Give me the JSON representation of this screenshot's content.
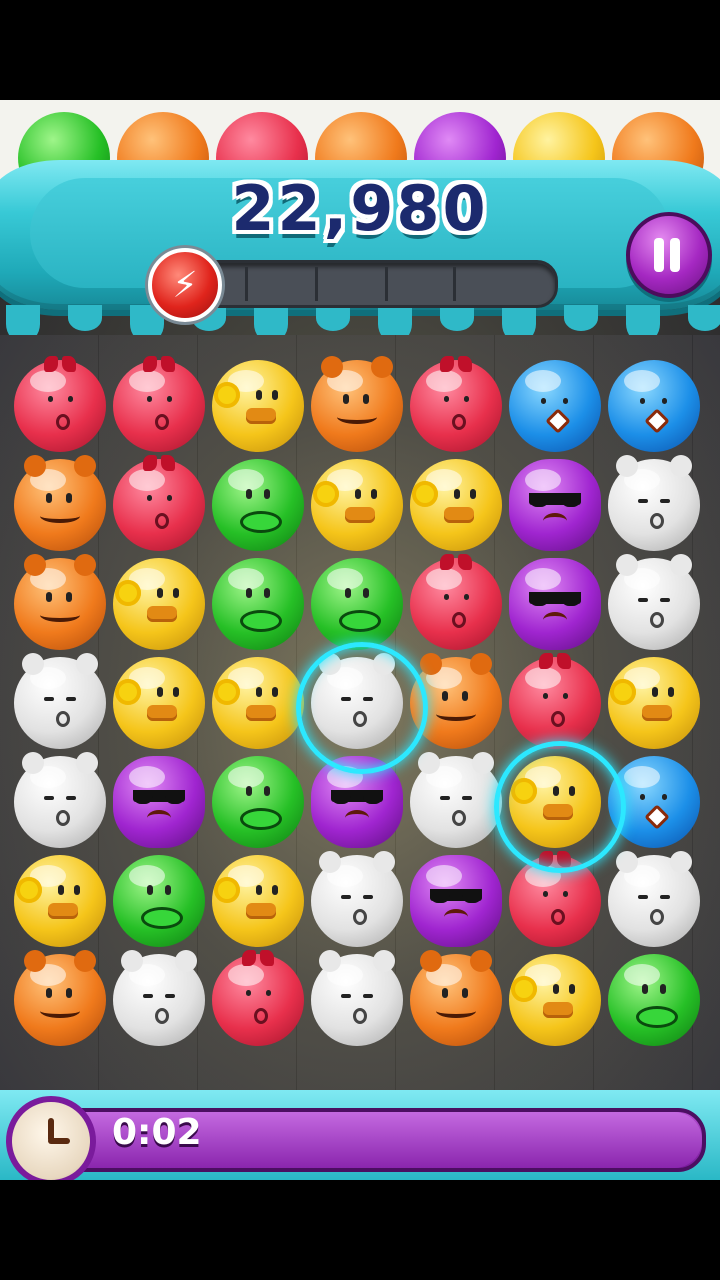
{
  "hud": {
    "score": "22,980",
    "timer": "0:02",
    "power_meter_fill": 0.0
  },
  "preview_row": [
    "green",
    "orange",
    "red",
    "orange",
    "purple",
    "yellow",
    "orange"
  ],
  "board": {
    "rows": [
      [
        "red",
        "red",
        "yellow",
        "orange",
        "red",
        "blue",
        "blue"
      ],
      [
        "orange",
        "red",
        "green",
        "yellow",
        "yellow",
        "purple",
        "white"
      ],
      [
        "orange",
        "yellow",
        "green",
        "green",
        "red",
        "purple",
        "white"
      ],
      [
        "white",
        "yellow",
        "yellow",
        "white",
        "orange",
        "red",
        "yellow"
      ],
      [
        "white",
        "purple",
        "green",
        "purple",
        "white",
        "yellow",
        "blue"
      ],
      [
        "yellow",
        "green",
        "yellow",
        "white",
        "purple",
        "red",
        "white"
      ],
      [
        "orange",
        "white",
        "red",
        "white",
        "orange",
        "yellow",
        "green"
      ]
    ],
    "highlighted": [
      [
        3,
        3
      ],
      [
        4,
        5
      ]
    ]
  },
  "colors": {
    "teal": "#2ab3c2",
    "purple": "#a025d0",
    "score_text": "#1c2a6e"
  },
  "icons": {
    "boost": "lightning-bolt-icon",
    "pause": "pause-icon",
    "timer": "clock-icon"
  }
}
